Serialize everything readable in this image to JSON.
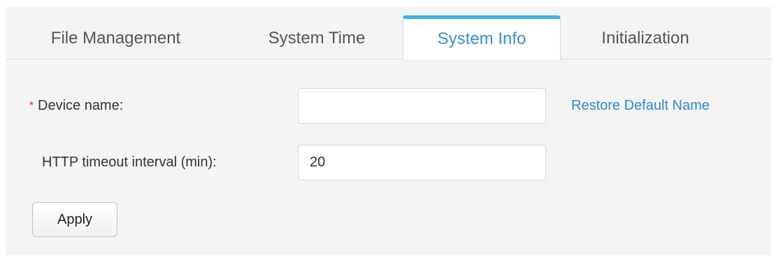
{
  "tabs": [
    {
      "label": "File Management",
      "active": false
    },
    {
      "label": "System Time",
      "active": false
    },
    {
      "label": "System Info",
      "active": true
    },
    {
      "label": "Initialization",
      "active": false
    }
  ],
  "form": {
    "device_name": {
      "required_mark": "*",
      "label": "Device name:",
      "value": ""
    },
    "restore_default_link": "Restore Default Name",
    "http_timeout": {
      "label": "HTTP timeout interval (min):",
      "value": "20"
    },
    "apply_label": "Apply"
  },
  "colors": {
    "accent_tab_top": "#3fb1e3",
    "active_tab_text": "#3a8fd0",
    "link": "#2f8ad2",
    "required_star": "#e2231a",
    "panel_bg": "#f4f4f4"
  }
}
